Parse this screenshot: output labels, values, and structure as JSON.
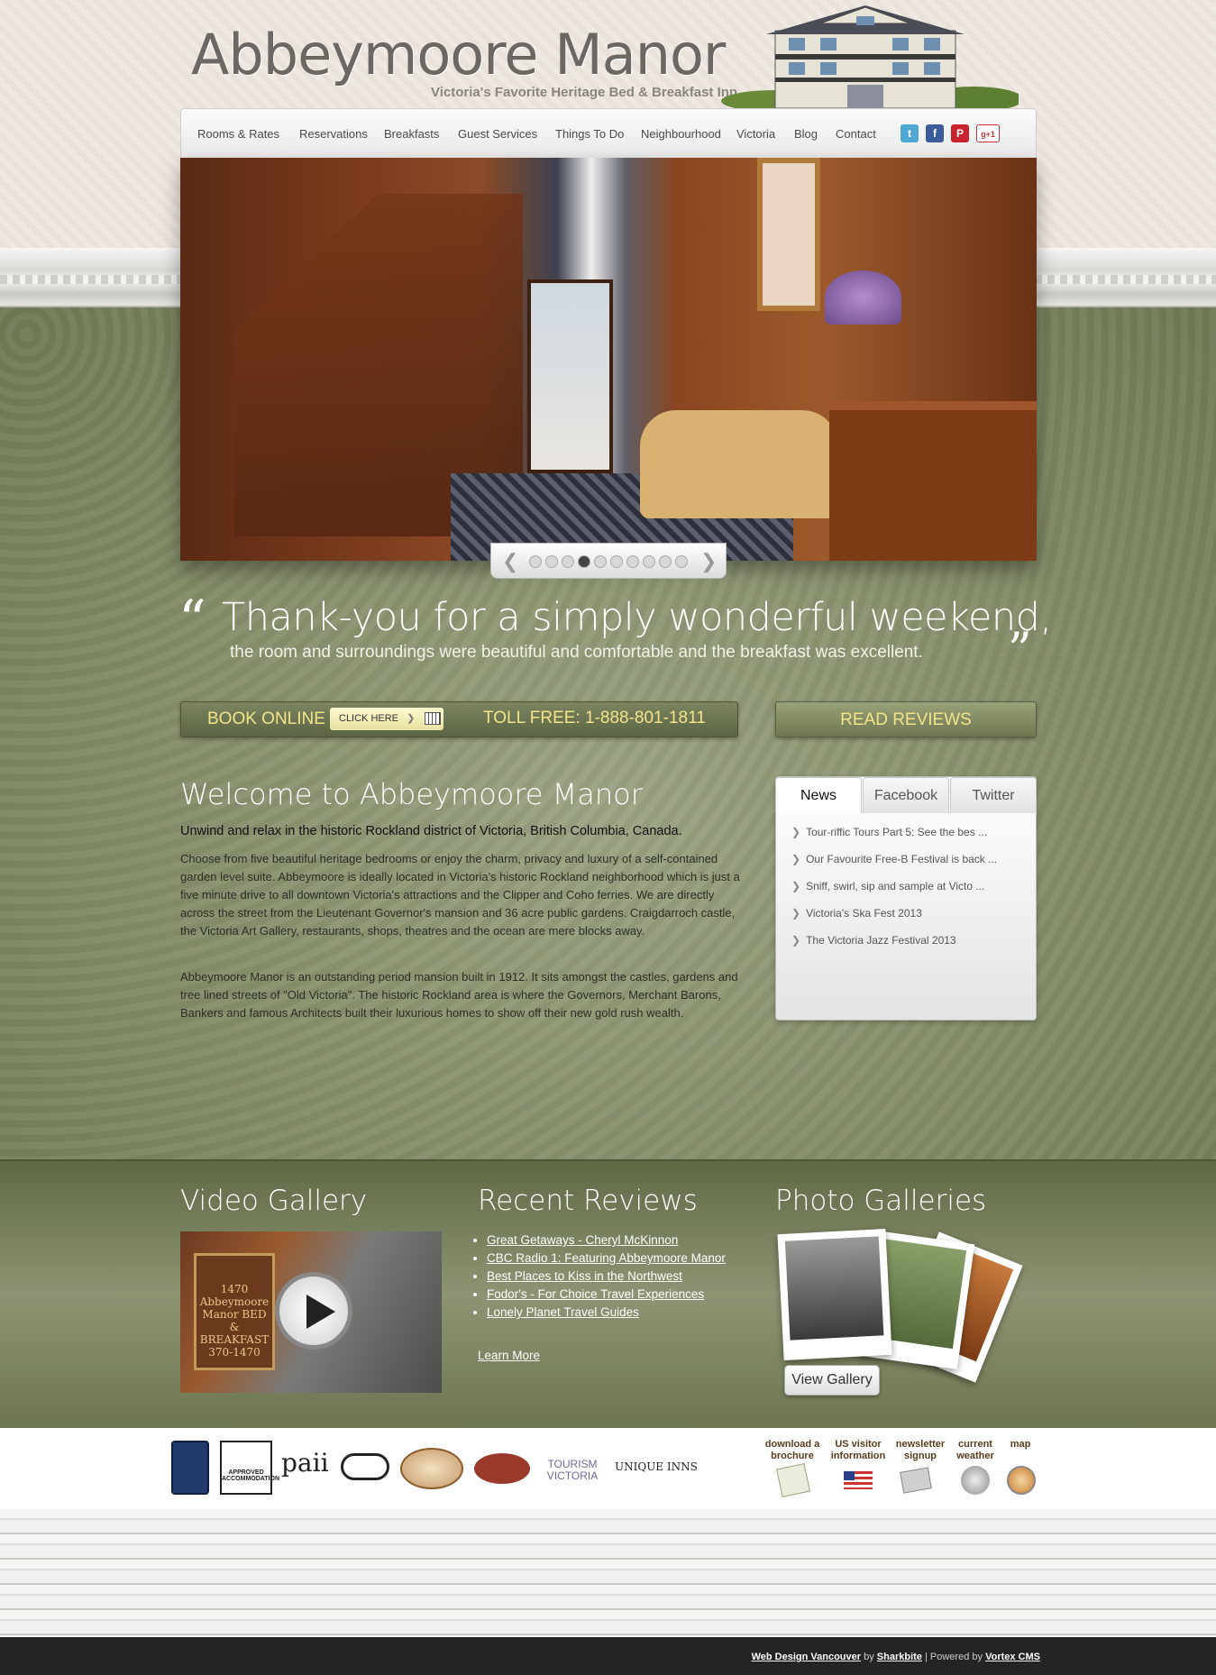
{
  "brand": {
    "title": "Abbeymoore Manor",
    "tagline": "Victoria's Favorite Heritage Bed & Breakfast Inn"
  },
  "nav": {
    "items": [
      "Rooms & Rates",
      "Reservations",
      "Breakfasts",
      "Guest Services",
      "Things To Do",
      "Neighbourhood",
      "Victoria",
      "Blog",
      "Contact"
    ]
  },
  "social": {
    "twitter": "t",
    "facebook": "f",
    "pinterest": "P",
    "googleplus": "g+1"
  },
  "slider": {
    "total_dots": 10,
    "active_dot": 4
  },
  "quote": {
    "main": "Thank-you for a simply wonderful weekend,",
    "sub": "the room and surroundings were beautiful and comfortable and the breakfast was excellent."
  },
  "booking": {
    "book_online": "BOOK ONLINE",
    "click_here": "CLICK HERE",
    "toll_free": "TOLL FREE: 1-888-801-1811",
    "read_reviews": "READ REVIEWS"
  },
  "welcome": {
    "title": "Welcome to Abbeymoore Manor",
    "lead": "Unwind and relax in the historic Rockland district of Victoria, British Columbia, Canada.",
    "p1": "Choose from five beautiful heritage bedrooms or enjoy the charm, privacy and luxury of a self-contained garden level suite. Abbeymoore is ideally located in Victoria's historic Rockland neighborhood which is just a five minute drive to all downtown Victoria's attractions and the Clipper and Coho ferries. We are directly across the street from the Lieutenant Governor's mansion and 36 acre public gardens. Craigdarroch castle, the Victoria Art Gallery, restaurants, shops, theatres and the ocean are mere blocks away.",
    "p2": "Abbeymoore Manor is an outstanding period mansion built in 1912. It sits amongst the castles, gardens and tree lined streets of \"Old Victoria\". The historic Rockland area is where the Governors, Merchant Barons, Bankers and famous Architects built their luxurious homes to show off their new gold rush wealth."
  },
  "tabs": {
    "items": [
      "News",
      "Facebook",
      "Twitter"
    ],
    "active": "News",
    "news": [
      "Tour-riffic Tours Part 5: See the bes ...",
      "Our Favourite Free-B Festival is back ...",
      "Sniff, swirl, sip and sample at Victo ...",
      "Victoria's Ska Fest 2013",
      "The Victoria Jazz Festival 2013"
    ]
  },
  "bottom": {
    "video_title": "Video Gallery",
    "video_sign": "1470 Abbeymoore Manor BED & BREAKFAST 370-1470",
    "reviews_title": "Recent Reviews",
    "reviews": [
      "Great Getaways - Cheryl McKinnon",
      "CBC Radio 1: Featuring Abbeymoore Manor",
      "Best Places to Kiss in the Northwest",
      "Fodor's - For Choice Travel Experiences",
      "Lonely Planet Travel Guides"
    ],
    "learn_more": "Learn More",
    "photos_title": "Photo Galleries",
    "view_gallery": "View Gallery"
  },
  "partners": {
    "approved": "APPROVED ACCOMMODATION",
    "paii": "paii",
    "tourism": "TOURISM VICTORIA",
    "unique": "UNIQUE INNS"
  },
  "utilities": [
    {
      "label": "download a brochure",
      "icon": "brochure-icon"
    },
    {
      "label": "US visitor information",
      "icon": "us-flag-icon"
    },
    {
      "label": "newsletter signup",
      "icon": "newsletter-icon"
    },
    {
      "label": "current weather",
      "icon": "weather-icon"
    },
    {
      "label": "map",
      "icon": "compass-icon"
    }
  ],
  "footer": {
    "web_design": "Web Design Vancouver",
    "by": "by",
    "sharkbite": "Sharkbite",
    "powered": "| Powered by",
    "vortex": "Vortex CMS"
  },
  "colors": {
    "green": "#838d68",
    "accent_yellow": "#f3e48a",
    "footer": "#242424"
  }
}
